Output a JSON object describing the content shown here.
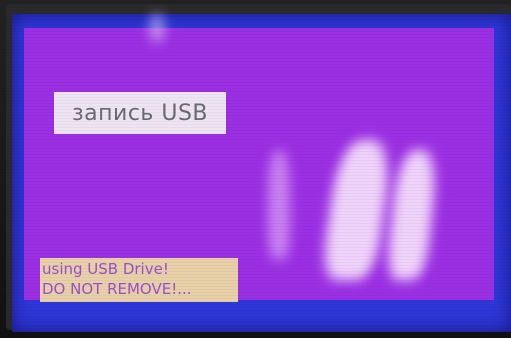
{
  "display": {
    "title": "запись USB",
    "status_line_1": "using USB Drive!",
    "status_line_2": "DO NOT REMOVE!..."
  },
  "colors": {
    "screen_border": "#2f37d8",
    "display_background": "#9b2fe4",
    "title_background": "#efe4f4",
    "status_background": "#e8d0a8",
    "status_text": "#9b4fd0"
  }
}
